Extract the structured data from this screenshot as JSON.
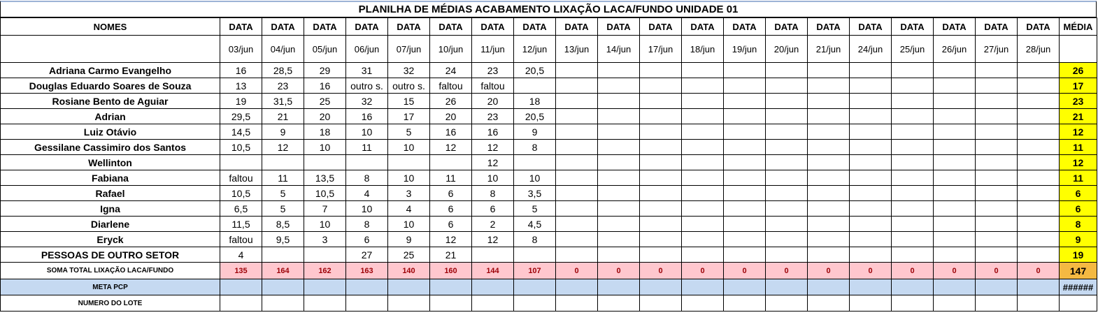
{
  "title": "PLANILHA DE MÉDIAS ACABAMENTO LIXAÇÃO LACA/FUNDO UNIDADE 01",
  "header": {
    "names_label": "NOMES",
    "date_label": "DATA",
    "media_label": "MÉDIA",
    "dates": [
      "03/jun",
      "04/jun",
      "05/jun",
      "06/jun",
      "07/jun",
      "10/jun",
      "11/jun",
      "12/jun",
      "13/jun",
      "14/jun",
      "17/jun",
      "18/jun",
      "19/jun",
      "20/jun",
      "21/jun",
      "24/jun",
      "25/jun",
      "26/jun",
      "27/jun",
      "28/jun"
    ]
  },
  "rows": [
    {
      "name": "Adriana Carmo Evangelho",
      "values": [
        "16",
        "28,5",
        "29",
        "31",
        "32",
        "24",
        "23",
        "20,5",
        "",
        "",
        "",
        "",
        "",
        "",
        "",
        "",
        "",
        "",
        "",
        ""
      ],
      "media": "26"
    },
    {
      "name": "Douglas Eduardo Soares de Souza",
      "values": [
        "13",
        "23",
        "16",
        "outro s.",
        "outro s.",
        "faltou",
        "faltou",
        "",
        "",
        "",
        "",
        "",
        "",
        "",
        "",
        "",
        "",
        "",
        "",
        ""
      ],
      "media": "17"
    },
    {
      "name": "Rosiane Bento de Aguiar",
      "values": [
        "19",
        "31,5",
        "25",
        "32",
        "15",
        "26",
        "20",
        "18",
        "",
        "",
        "",
        "",
        "",
        "",
        "",
        "",
        "",
        "",
        "",
        ""
      ],
      "media": "23"
    },
    {
      "name": "Adrian",
      "values": [
        "29,5",
        "21",
        "20",
        "16",
        "17",
        "20",
        "23",
        "20,5",
        "",
        "",
        "",
        "",
        "",
        "",
        "",
        "",
        "",
        "",
        "",
        ""
      ],
      "media": "21"
    },
    {
      "name": "Luiz Otávio",
      "values": [
        "14,5",
        "9",
        "18",
        "10",
        "5",
        "16",
        "16",
        "9",
        "",
        "",
        "",
        "",
        "",
        "",
        "",
        "",
        "",
        "",
        "",
        ""
      ],
      "media": "12"
    },
    {
      "name": "Gessilane Cassimiro dos Santos",
      "values": [
        "10,5",
        "12",
        "10",
        "11",
        "10",
        "12",
        "12",
        "8",
        "",
        "",
        "",
        "",
        "",
        "",
        "",
        "",
        "",
        "",
        "",
        ""
      ],
      "media": "11"
    },
    {
      "name": "Wellinton",
      "values": [
        "",
        "",
        "",
        "",
        "",
        "",
        "12",
        "",
        "",
        "",
        "",
        "",
        "",
        "",
        "",
        "",
        "",
        "",
        "",
        ""
      ],
      "media": "12"
    },
    {
      "name": "Fabiana",
      "values": [
        "faltou",
        "11",
        "13,5",
        "8",
        "10",
        "11",
        "10",
        "10",
        "",
        "",
        "",
        "",
        "",
        "",
        "",
        "",
        "",
        "",
        "",
        ""
      ],
      "media": "11"
    },
    {
      "name": "Rafael",
      "values": [
        "10,5",
        "5",
        "10,5",
        "4",
        "3",
        "6",
        "8",
        "3,5",
        "",
        "",
        "",
        "",
        "",
        "",
        "",
        "",
        "",
        "",
        "",
        ""
      ],
      "media": "6"
    },
    {
      "name": "Igna",
      "values": [
        "6,5",
        "5",
        "7",
        "10",
        "4",
        "6",
        "6",
        "5",
        "",
        "",
        "",
        "",
        "",
        "",
        "",
        "",
        "",
        "",
        "",
        ""
      ],
      "media": "6"
    },
    {
      "name": "Diarlene",
      "values": [
        "11,5",
        "8,5",
        "10",
        "8",
        "10",
        "6",
        "2",
        "4,5",
        "",
        "",
        "",
        "",
        "",
        "",
        "",
        "",
        "",
        "",
        "",
        ""
      ],
      "media": "8"
    },
    {
      "name": "Eryck",
      "values": [
        "faltou",
        "9,5",
        "3",
        "6",
        "9",
        "12",
        "12",
        "8",
        "",
        "",
        "",
        "",
        "",
        "",
        "",
        "",
        "",
        "",
        "",
        ""
      ],
      "media": "9"
    },
    {
      "name": "PESSOAS DE OUTRO SETOR",
      "values": [
        "4",
        "",
        "",
        "27",
        "25",
        "21",
        "",
        "",
        "",
        "",
        "",
        "",
        "",
        "",
        "",
        "",
        "",
        "",
        "",
        ""
      ],
      "media": "19"
    }
  ],
  "soma": {
    "label": "SOMA TOTAL LIXAÇÃO LACA/FUNDO",
    "values": [
      "135",
      "164",
      "162",
      "163",
      "140",
      "160",
      "144",
      "107",
      "0",
      "0",
      "0",
      "0",
      "0",
      "0",
      "0",
      "0",
      "0",
      "0",
      "0",
      "0"
    ],
    "media": "147"
  },
  "meta": {
    "label": "META PCP",
    "media": "######"
  },
  "lote": {
    "label": "NUMERO DO LOTE"
  },
  "colors": {
    "media_fill": "#ffff00",
    "soma_fill": "#ffc7ce",
    "soma_text": "#9c0006",
    "soma_media_fill": "#f4b942",
    "meta_fill": "#c5d9f1"
  }
}
